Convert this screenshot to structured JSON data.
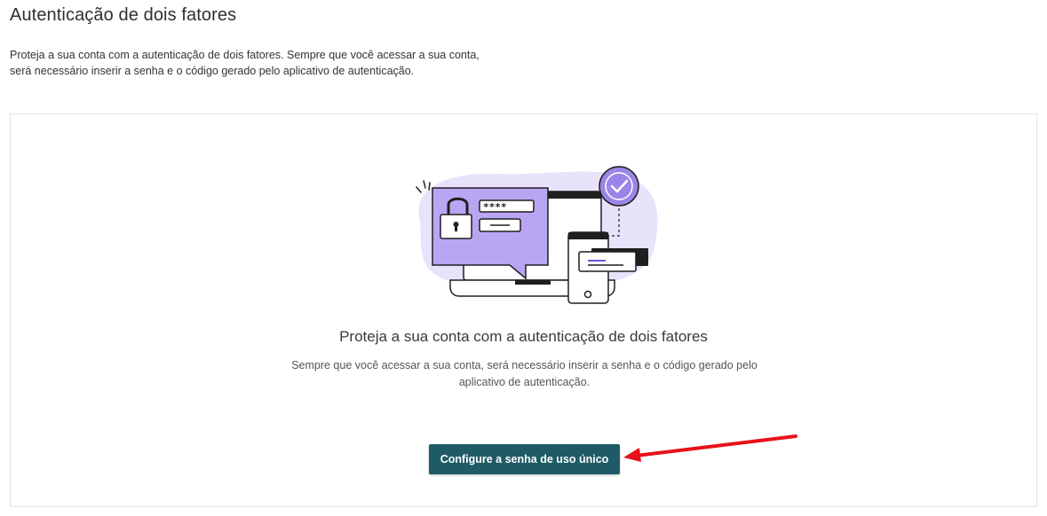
{
  "header": {
    "title": "Autenticação de dois fatores",
    "description": "Proteja a sua conta com a autenticação de dois fatores. Sempre que você acessar a sua conta, será necessário inserir a senha e o código gerado pelo aplicativo de autenticação."
  },
  "card": {
    "illustration_icon": "two-factor-auth-illustration",
    "password_mask": "****",
    "title": "Proteja a sua conta com a autenticação de dois fatores",
    "description": "Sempre que você acessar a sua conta, será necessário inserir a senha e o código gerado pelo aplicativo de autenticação.",
    "button_label": "Configure a senha de uso único"
  },
  "annotation": {
    "arrow_icon": "red-arrow-icon",
    "arrow_color": "#e8111b"
  },
  "colors": {
    "primary_button": "#1e5b66",
    "illustration_accent": "#b9a6f2",
    "illustration_blob": "#e9e2fb",
    "check_circle": "#9a86e8"
  }
}
